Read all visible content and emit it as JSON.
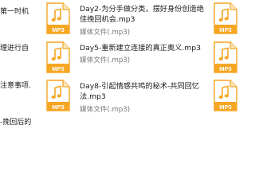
{
  "colors": {
    "icon_orange": "#F5A623",
    "icon_orange_light": "#FDE6BE",
    "text_primary": "#1A1A1A",
    "text_secondary": "#777777"
  },
  "left_fragments": [
    "第一时机",
    "理进行自",
    "注意事项.",
    "-挽回后的"
  ],
  "files": [
    {
      "name": "Day2-为分手做分类，摆好身份创造绝佳挽回机会.mp3",
      "type": "媒体文件(.mp3)",
      "icon_label": "MP3",
      "icon": "mp3-file-icon"
    },
    {
      "name": "Day5-重新建立连接的真正奥义.mp3",
      "type": "媒体文件(.mp3)",
      "icon_label": "MP3",
      "icon": "mp3-file-icon"
    },
    {
      "name": "Day8-引起情感共鸣的秘术-共同回忆法.mp3",
      "type": "媒体文件(.mp3)",
      "icon_label": "MP3",
      "icon": "mp3-file-icon"
    }
  ],
  "right_icons": [
    {
      "icon_label": "MP3",
      "icon": "mp3-file-icon"
    },
    {
      "icon_label": "MP3",
      "icon": "mp3-file-icon"
    },
    {
      "icon_label": "MP3",
      "icon": "mp3-file-icon"
    }
  ]
}
